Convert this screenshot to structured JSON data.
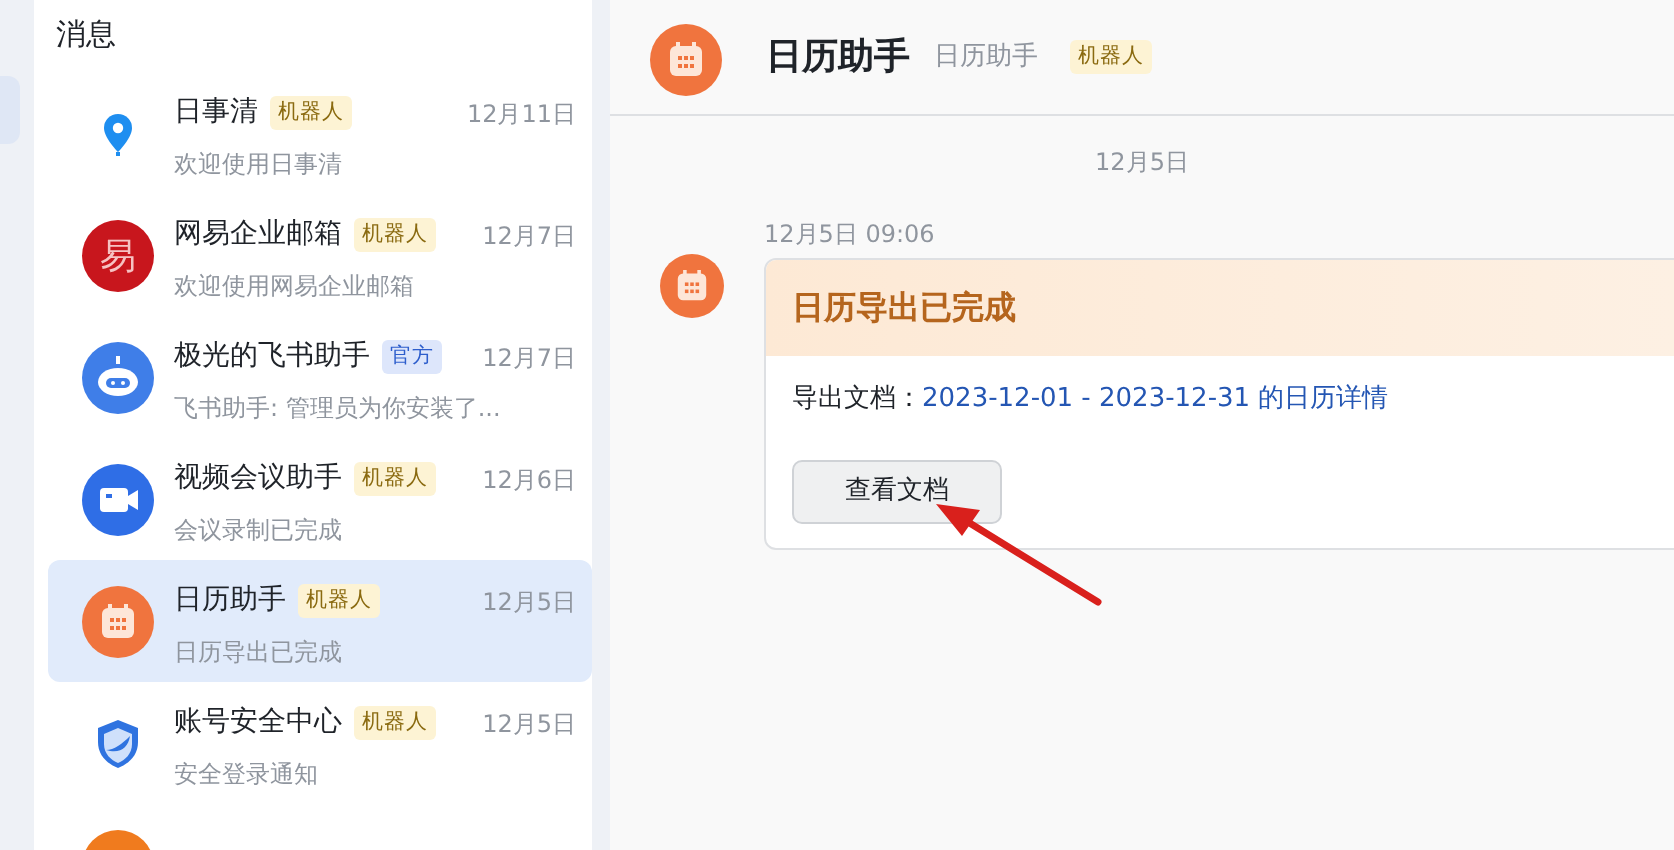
{
  "sidebar": {
    "title": "消息",
    "items": [
      {
        "avatar": {
          "kind": "pin"
        },
        "name": "日事清",
        "tag": {
          "text": "机器人",
          "kind": "robot"
        },
        "date": "12月11日",
        "preview": "欢迎使用日事清",
        "selected": false
      },
      {
        "avatar": {
          "kind": "letter",
          "text": "易"
        },
        "name": "网易企业邮箱",
        "tag": {
          "text": "机器人",
          "kind": "robot"
        },
        "date": "12月7日",
        "preview": "欢迎使用网易企业邮箱",
        "selected": false
      },
      {
        "avatar": {
          "kind": "bot"
        },
        "name": "极光的飞书助手",
        "tag": {
          "text": "官方",
          "kind": "official"
        },
        "date": "12月7日",
        "preview": "飞书助手: 管理员为你安装了...",
        "selected": false
      },
      {
        "avatar": {
          "kind": "video"
        },
        "name": "视频会议助手",
        "tag": {
          "text": "机器人",
          "kind": "robot"
        },
        "date": "12月6日",
        "preview": "会议录制已完成",
        "selected": false
      },
      {
        "avatar": {
          "kind": "calendar"
        },
        "name": "日历助手",
        "tag": {
          "text": "机器人",
          "kind": "robot"
        },
        "date": "12月5日",
        "preview": "日历导出已完成",
        "selected": true
      },
      {
        "avatar": {
          "kind": "shield"
        },
        "name": "账号安全中心",
        "tag": {
          "text": "机器人",
          "kind": "robot"
        },
        "date": "12月5日",
        "preview": "安全登录通知",
        "selected": false
      },
      {
        "avatar": {
          "kind": "orange"
        },
        "selected": false
      }
    ]
  },
  "chat": {
    "title": "日历助手",
    "subtitle": "日历助手",
    "tag": {
      "text": "机器人",
      "kind": "robot"
    },
    "date_divider": "12月5日",
    "messages": [
      {
        "time": "12月5日 09:06",
        "card": {
          "title": "日历导出已完成",
          "label": "导出文档：",
          "link": "2023-12-01 - 2023-12-31 的日历详情",
          "button": "查看文档"
        }
      }
    ]
  },
  "annotations": [
    {
      "kind": "arrow"
    }
  ]
}
